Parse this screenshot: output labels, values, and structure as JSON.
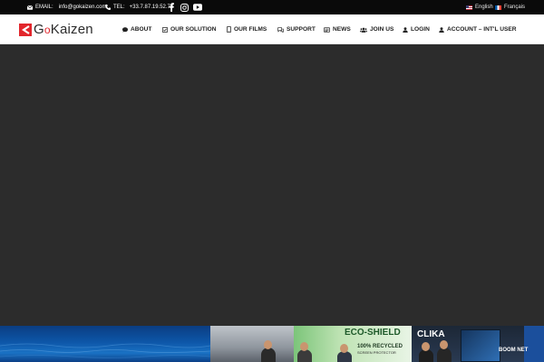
{
  "topbar": {
    "email_label": "EMAIL:",
    "email_value": "info@gokaizen.com",
    "tel_label": "TEL:",
    "tel_value": "+33.7.87.19.52.70",
    "social": [
      "facebook-icon",
      "instagram-icon",
      "youtube-icon"
    ],
    "languages": [
      {
        "label": "English",
        "flag": "uk-flag"
      },
      {
        "label": "Français",
        "flag": "fr-flag"
      }
    ]
  },
  "header": {
    "logo": {
      "prefix": "G",
      "small": "o",
      "name": "Kaizen",
      "brand_color": "#e2262c"
    },
    "nav": [
      {
        "label": "ABOUT",
        "icon": "chat-icon"
      },
      {
        "label": "OUR SOLUTION",
        "icon": "checkbox-icon"
      },
      {
        "label": "OUR FILMS",
        "icon": "tablet-icon"
      },
      {
        "label": "SUPPORT",
        "icon": "support-icon"
      },
      {
        "label": "NEWS",
        "icon": "newspaper-icon"
      },
      {
        "label": "JOIN US",
        "icon": "users-icon"
      },
      {
        "label": "LOGIN",
        "icon": "user-icon"
      },
      {
        "label": "ACCOUNT – INT'L USER",
        "icon": "user-icon"
      }
    ]
  },
  "hero": {
    "background": "#2c2c2c"
  },
  "strip": {
    "banner_eco": "ECO-SHIELD",
    "banner_eco_sub": "100% RECYCLED",
    "banner_eco_sub2": "SCREEN PROTECTOR",
    "banner_clika": "CLIKA",
    "banner_boom": "BOOM NET"
  },
  "colors": {
    "accent": "#e2262c",
    "topbar": "#0a0a0a",
    "hero": "#2c2c2c"
  }
}
